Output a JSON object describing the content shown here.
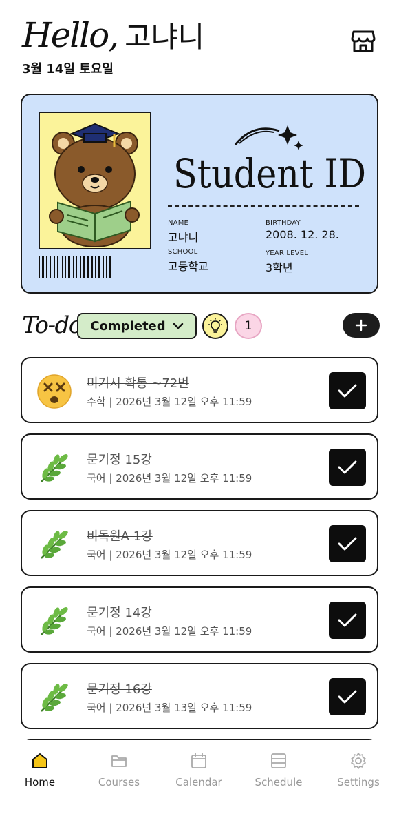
{
  "header": {
    "hello": "Hello,",
    "user_name": "고냐니",
    "date": "3월 14일 토요일",
    "store_icon": "store-icon"
  },
  "id_card": {
    "title": "Student ID",
    "name_label": "NAME",
    "name": "고냐니",
    "birthday_label": "BIRTHDAY",
    "birthday": "2008. 12. 28.",
    "school_label": "SCHOOL",
    "school": "고등학교",
    "year_label": "YEAR LEVEL",
    "year": "3학년",
    "colors": {
      "card_bg": "#cfe2fb",
      "photo_bg": "#fbf39a"
    }
  },
  "todo": {
    "title": "To-do",
    "filter_label": "Completed",
    "count": "1",
    "colors": {
      "filter_bg": "#d4ecc9",
      "bulb_bg": "#fbf39a",
      "count_bg": "#fbd6e6"
    }
  },
  "tasks": [
    {
      "icon": "dizzy-face-icon",
      "title": "미기시 확통 ~72번",
      "meta": "수학 | 2026년 3월 12일 오후 11:59",
      "done": true
    },
    {
      "icon": "herb-icon",
      "title": "문기정 15강",
      "meta": "국어 | 2026년 3월 12일 오후 11:59",
      "done": true
    },
    {
      "icon": "herb-icon",
      "title": "비독원A 1강",
      "meta": "국어 | 2026년 3월 12일 오후 11:59",
      "done": true
    },
    {
      "icon": "herb-icon",
      "title": "문기정 14강",
      "meta": "국어 | 2026년 3월 12일 오후 11:59",
      "done": true
    },
    {
      "icon": "herb-icon",
      "title": "문기정 16강",
      "meta": "국어 | 2026년 3월 13일 오후 11:59",
      "done": true
    }
  ],
  "nav": [
    {
      "label": "Home",
      "icon": "home-icon",
      "active": true
    },
    {
      "label": "Courses",
      "icon": "folder-icon",
      "active": false
    },
    {
      "label": "Calendar",
      "icon": "calendar-icon",
      "active": false
    },
    {
      "label": "Schedule",
      "icon": "schedule-icon",
      "active": false
    },
    {
      "label": "Settings",
      "icon": "gear-icon",
      "active": false
    }
  ]
}
